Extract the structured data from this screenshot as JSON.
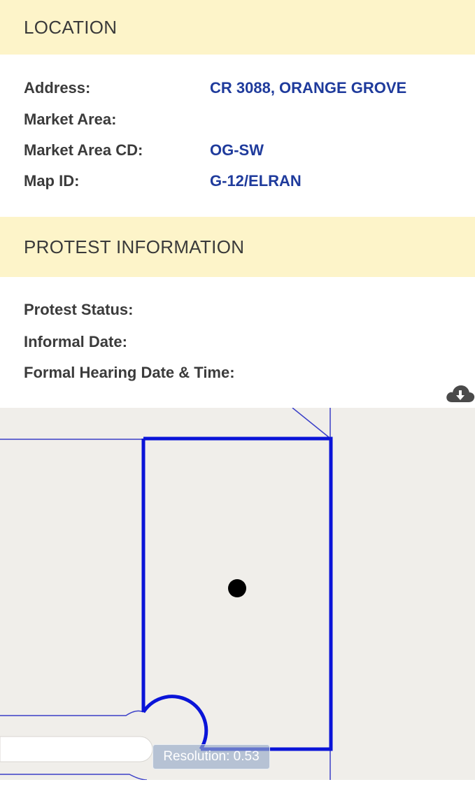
{
  "location": {
    "title": "LOCATION",
    "fields": [
      {
        "label": "Address:",
        "value": "CR 3088, ORANGE GROVE"
      },
      {
        "label": "Market Area:",
        "value": ""
      },
      {
        "label": "Market Area CD:",
        "value": "OG-SW"
      },
      {
        "label": "Map ID:",
        "value": "G-12/ELRAN"
      }
    ]
  },
  "protest": {
    "title": "PROTEST INFORMATION",
    "fields": [
      {
        "label": "Protest Status:",
        "value": ""
      },
      {
        "label": "Informal Date:",
        "value": ""
      },
      {
        "label": "Formal Hearing Date & Time:",
        "value": ""
      }
    ]
  },
  "map": {
    "resolution_text": "Resolution: 0.53",
    "download_icon": "cloud-download-icon",
    "colors": {
      "background": "#f0eeea",
      "parcel_highlight": "#0a14d8",
      "parcel_lines": "#3a3fc8",
      "marker": "#000000",
      "section_header": "#fdf4c9",
      "value_text": "#1f3b9c"
    }
  }
}
